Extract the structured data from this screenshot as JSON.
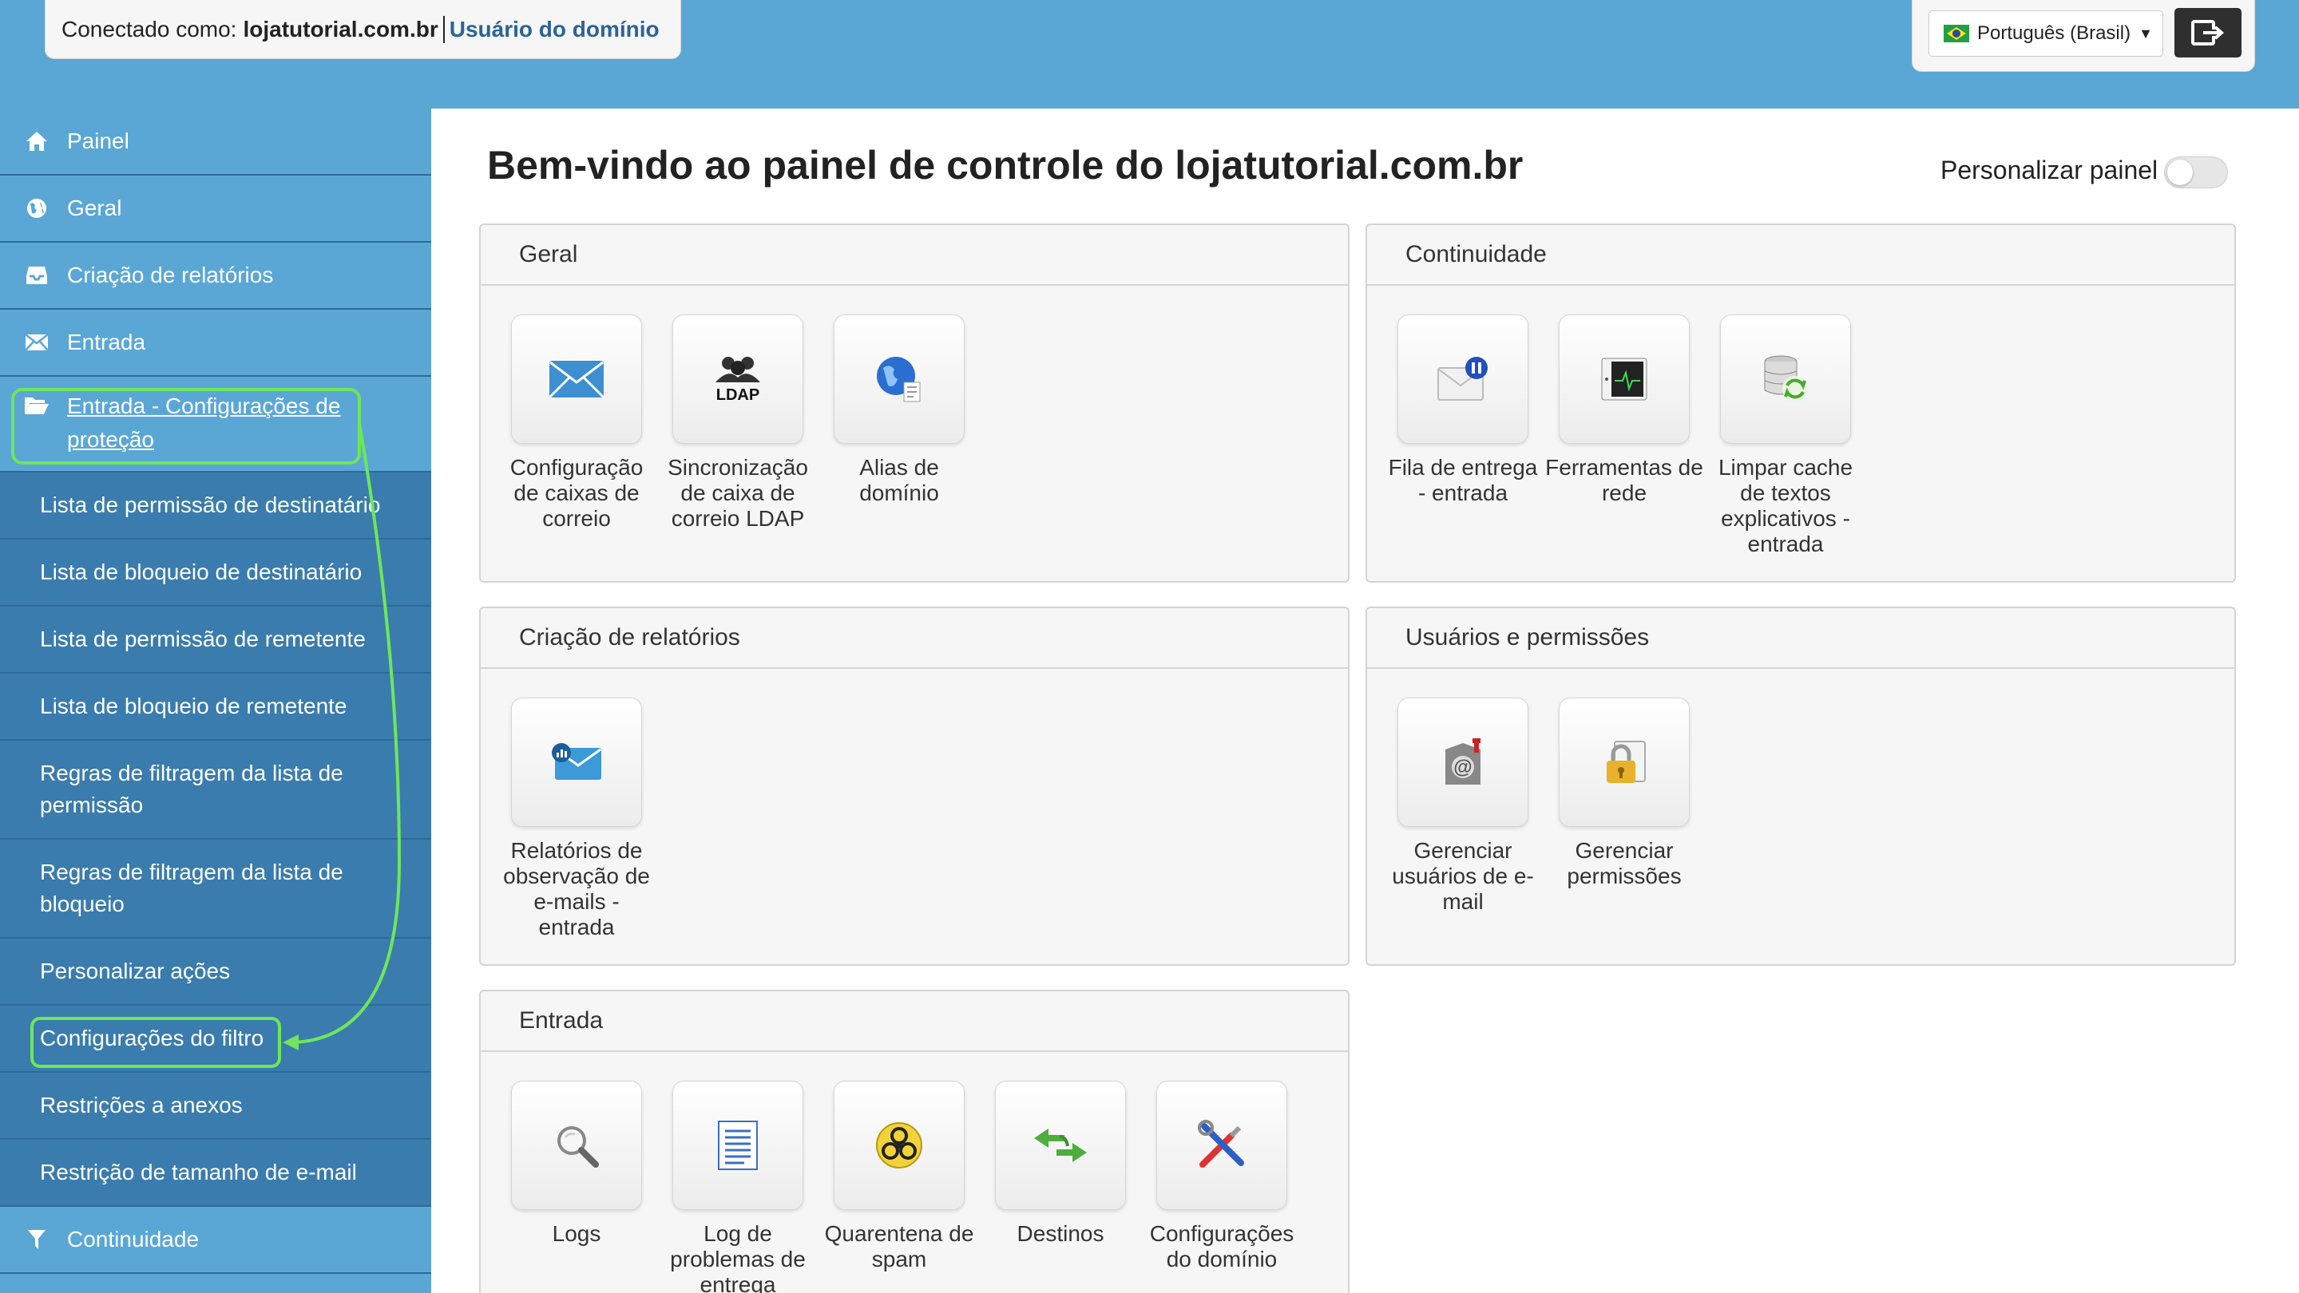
{
  "header": {
    "connected_prefix": "Conectado como:",
    "connected_domain": "lojatutorial.com.br",
    "user_role": "Usuário do domínio",
    "language": "Português (Brasil)"
  },
  "sidebar": {
    "items": [
      {
        "label": "Painel",
        "icon": "home-icon"
      },
      {
        "label": "Geral",
        "icon": "globe-icon"
      },
      {
        "label": "Criação de relatórios",
        "icon": "inbox-icon"
      },
      {
        "label": "Entrada",
        "icon": "envelope-icon"
      },
      {
        "label": "Entrada - Configurações de proteção",
        "icon": "folder-open-icon"
      }
    ],
    "subitems": [
      "Lista de permissão de destinatário",
      "Lista de bloqueio de destinatário",
      "Lista de permissão de remetente",
      "Lista de bloqueio de remetente",
      "Regras de filtragem da lista de permissão",
      "Regras de filtragem da lista de bloqueio",
      "Personalizar ações",
      "Configurações do filtro",
      "Restrições a anexos",
      "Restrição de tamanho de e-mail"
    ],
    "continuity": {
      "label": "Continuidade",
      "icon": "filter-icon"
    }
  },
  "main": {
    "title": "Bem-vindo ao painel de controle do lojatutorial.com.br",
    "personalize_label": "Personalizar painel",
    "personalize_on": false,
    "panels": {
      "geral": {
        "title": "Geral",
        "tiles": [
          "Configuração de caixas de correio",
          "Sincronização de caixa de correio LDAP",
          "Alias de domínio"
        ]
      },
      "continuidade": {
        "title": "Continuidade",
        "tiles": [
          "Fila de entrega - entrada",
          "Ferramentas de rede",
          "Limpar cache de textos explicativos - entrada"
        ]
      },
      "relatorios": {
        "title": "Criação de relatórios",
        "tiles": [
          "Relatórios de observação de e-mails - entrada"
        ]
      },
      "usuarios": {
        "title": "Usuários e permissões",
        "tiles": [
          "Gerenciar usuários de e-mail",
          "Gerenciar permissões"
        ]
      },
      "entrada": {
        "title": "Entrada",
        "tiles": [
          "Logs",
          "Log de problemas de entrega",
          "Quarentena de spam",
          "Destinos",
          "Configurações do domínio"
        ]
      }
    },
    "ldap_text": "LDAP"
  },
  "colors": {
    "header_bg": "#5aa7d6",
    "sidebar_sub_bg": "#3a7cad",
    "highlight": "#6ee65b",
    "link": "#2a6496"
  }
}
